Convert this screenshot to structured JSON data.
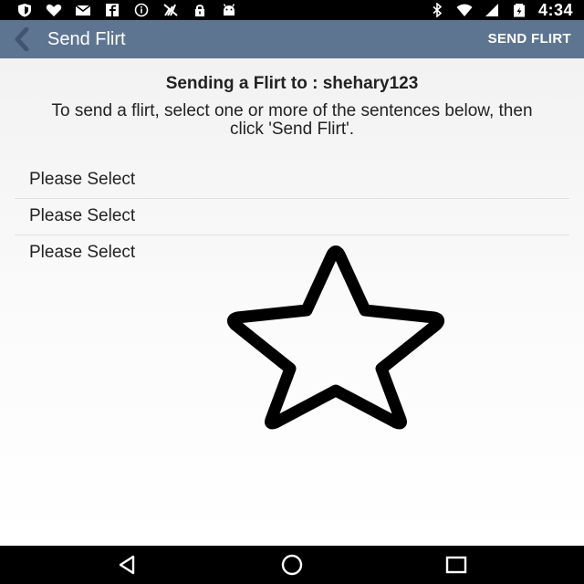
{
  "status_bar": {
    "time": "4:34",
    "left_icons": [
      "shield-icon",
      "heart-icon",
      "mail-icon",
      "facebook-icon",
      "info-icon",
      "no-signal-icon",
      "lock-icon",
      "android-icon"
    ],
    "right_icons": [
      "bluetooth-icon",
      "wifi-icon",
      "signal-icon",
      "battery-icon"
    ]
  },
  "action_bar": {
    "title": "Send Flirt",
    "action_label": "SEND FLIRT",
    "color": "#5e7591"
  },
  "content": {
    "heading": "Sending a Flirt to : shehary123",
    "instructions": "To send a flirt, select one or more of the sentences below, then click 'Send Flirt'.",
    "selects": [
      {
        "label": "Please Select"
      },
      {
        "label": "Please Select"
      },
      {
        "label": "Please Select"
      }
    ],
    "star_icon": "star-outline-icon"
  },
  "nav_bar": {
    "buttons": [
      "back-nav-icon",
      "home-nav-icon",
      "recents-nav-icon"
    ]
  }
}
